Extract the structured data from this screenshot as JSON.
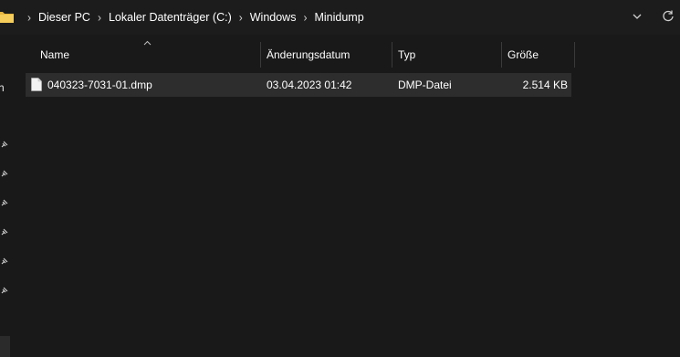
{
  "breadcrumb": {
    "items": [
      "Dieser PC",
      "Lokaler Datenträger (C:)",
      "Windows",
      "Minidump"
    ],
    "separator": "›"
  },
  "sidebar": {
    "partial_label": "h"
  },
  "columns": {
    "name": "Name",
    "date": "Änderungsdatum",
    "type": "Typ",
    "size": "Größe"
  },
  "files": [
    {
      "name": "040323-7031-01.dmp",
      "date": "03.04.2023 01:42",
      "type": "DMP-Datei",
      "size": "2.514 KB"
    }
  ],
  "icons": {
    "folder": "folder-icon",
    "file": "file-icon",
    "dropdown": "chevron-down-icon",
    "refresh": "refresh-icon",
    "pin": "pin-icon",
    "sort": "sort-ascending-icon"
  },
  "colors": {
    "background": "#191919",
    "selected_row": "#2d2d2d",
    "folder_yellow": "#f0c040",
    "text": "#ffffff"
  }
}
